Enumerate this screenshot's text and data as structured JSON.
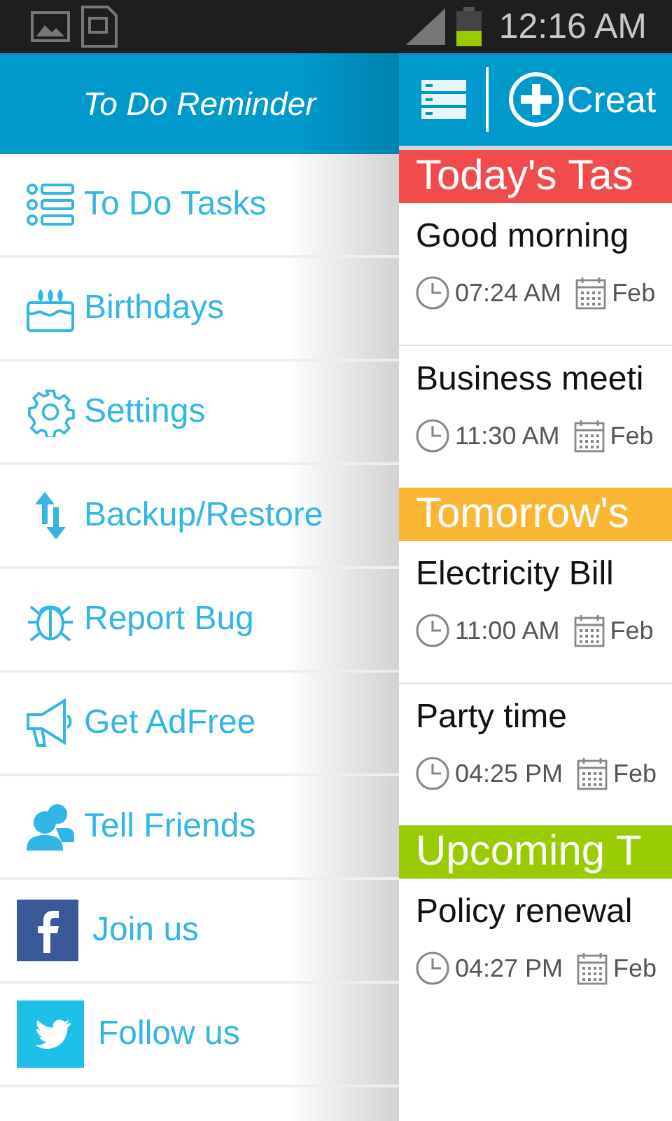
{
  "status_bar": {
    "time": "12:16 AM"
  },
  "drawer": {
    "title": "To Do Reminder",
    "items": [
      {
        "label": "To Do Tasks",
        "kind": "menu"
      },
      {
        "label": "Birthdays",
        "kind": "menu"
      },
      {
        "label": "Settings",
        "kind": "menu"
      },
      {
        "label": "Backup/Restore",
        "kind": "menu"
      },
      {
        "label": "Report Bug",
        "kind": "menu"
      },
      {
        "label": "Get AdFree",
        "kind": "menu"
      },
      {
        "label": "Tell Friends",
        "kind": "menu"
      },
      {
        "label": "Join us",
        "kind": "social"
      },
      {
        "label": "Follow us",
        "kind": "social"
      }
    ]
  },
  "toolbar": {
    "create_label": "Creat"
  },
  "sections": [
    {
      "title": "Today's Tas",
      "color": "#f24b4b",
      "tasks": [
        {
          "title": "Good morning",
          "time": "07:24 AM",
          "date": "Feb"
        },
        {
          "title": "Business meeti",
          "time": "11:30 AM",
          "date": "Feb"
        }
      ]
    },
    {
      "title": "Tomorrow's",
      "color": "#fbb634",
      "tasks": [
        {
          "title": "Electricity Bill",
          "time": "11:00 AM",
          "date": "Feb"
        },
        {
          "title": "Party time",
          "time": "04:25 PM",
          "date": "Feb"
        }
      ]
    },
    {
      "title": "Upcoming T",
      "color": "#99cc00",
      "tasks": [
        {
          "title": "Policy renewal",
          "time": "04:27 PM",
          "date": "Feb"
        }
      ]
    }
  ]
}
